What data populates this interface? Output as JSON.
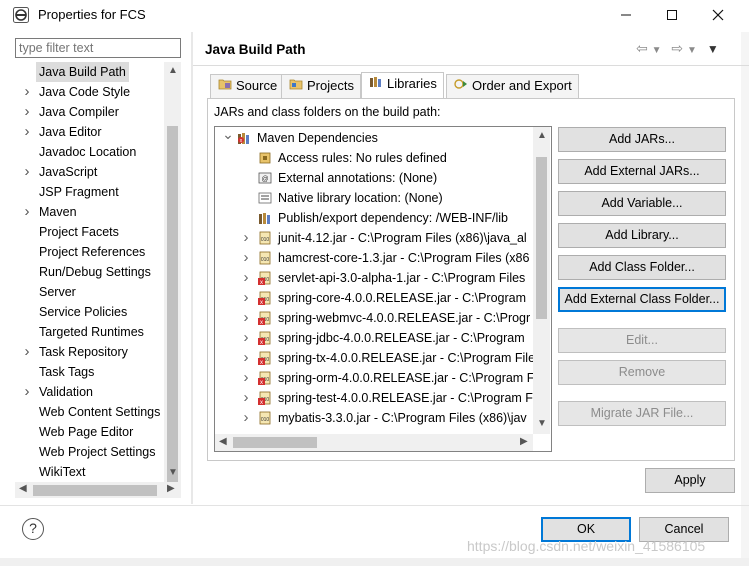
{
  "window": {
    "title": "Properties for FCS",
    "minimize": "—",
    "maximize": "☐",
    "close": "✕"
  },
  "filter": {
    "placeholder": "type filter text"
  },
  "sidebar": {
    "items": [
      {
        "label": "Java Build Path",
        "expandable": false,
        "selected": true
      },
      {
        "label": "Java Code Style",
        "expandable": true
      },
      {
        "label": "Java Compiler",
        "expandable": true
      },
      {
        "label": "Java Editor",
        "expandable": true
      },
      {
        "label": "Javadoc Location",
        "expandable": false
      },
      {
        "label": "JavaScript",
        "expandable": true
      },
      {
        "label": "JSP Fragment",
        "expandable": false
      },
      {
        "label": "Maven",
        "expandable": true
      },
      {
        "label": "Project Facets",
        "expandable": false
      },
      {
        "label": "Project References",
        "expandable": false
      },
      {
        "label": "Run/Debug Settings",
        "expandable": false
      },
      {
        "label": "Server",
        "expandable": false
      },
      {
        "label": "Service Policies",
        "expandable": false
      },
      {
        "label": "Targeted Runtimes",
        "expandable": false
      },
      {
        "label": "Task Repository",
        "expandable": true
      },
      {
        "label": "Task Tags",
        "expandable": false
      },
      {
        "label": "Validation",
        "expandable": true
      },
      {
        "label": "Web Content Settings",
        "expandable": false
      },
      {
        "label": "Web Page Editor",
        "expandable": false
      },
      {
        "label": "Web Project Settings",
        "expandable": false
      },
      {
        "label": "WikiText",
        "expandable": false
      }
    ]
  },
  "page": {
    "title": "Java Build Path",
    "nav": "⇦ ▾ ⇨ ▾ ▾"
  },
  "tabs": [
    {
      "label": "Source",
      "active": false
    },
    {
      "label": "Projects",
      "active": false
    },
    {
      "label": "Libraries",
      "active": true
    },
    {
      "label": "Order and Export",
      "active": false
    }
  ],
  "libraries": {
    "subtitle": "JARs and class folders on the build path:",
    "root": {
      "label": "Maven Dependencies",
      "expanded": true
    },
    "attributes": [
      "Access rules: No rules defined",
      "External annotations: (None)",
      "Native library location: (None)",
      "Publish/export dependency: /WEB-INF/lib"
    ],
    "jars": [
      {
        "label": "junit-4.12.jar - C:\\Program Files (x86)\\java_al",
        "missing": false
      },
      {
        "label": "hamcrest-core-1.3.jar - C:\\Program Files (x86",
        "missing": false
      },
      {
        "label": "servlet-api-3.0-alpha-1.jar - C:\\Program Files",
        "missing": true
      },
      {
        "label": "spring-core-4.0.0.RELEASE.jar - C:\\Program",
        "missing": true
      },
      {
        "label": "spring-webmvc-4.0.0.RELEASE.jar - C:\\Progr",
        "missing": true
      },
      {
        "label": "spring-jdbc-4.0.0.RELEASE.jar - C:\\Program",
        "missing": true
      },
      {
        "label": "spring-tx-4.0.0.RELEASE.jar - C:\\Program File",
        "missing": true
      },
      {
        "label": "spring-orm-4.0.0.RELEASE.jar - C:\\Program F",
        "missing": true
      },
      {
        "label": "spring-test-4.0.0.RELEASE.jar - C:\\Program F",
        "missing": true
      },
      {
        "label": "mybatis-3.3.0.jar - C:\\Program Files (x86)\\jav",
        "missing": false
      }
    ]
  },
  "buttons": {
    "add_jars": "Add JARs...",
    "add_external_jars": "Add External JARs...",
    "add_variable": "Add Variable...",
    "add_library": "Add Library...",
    "add_class_folder": "Add Class Folder...",
    "add_external_class_folder": "Add External Class Folder...",
    "edit": "Edit...",
    "remove": "Remove",
    "migrate_jar": "Migrate JAR File...",
    "apply": "Apply",
    "ok": "OK",
    "cancel": "Cancel"
  },
  "help": "?",
  "watermark": "https://blog.csdn.net/weixin_41586105",
  "colors": {
    "accent": "#0078d7",
    "selection": "#dcdcdc",
    "button_face": "#e1e1e1",
    "error": "#d32f2f"
  }
}
